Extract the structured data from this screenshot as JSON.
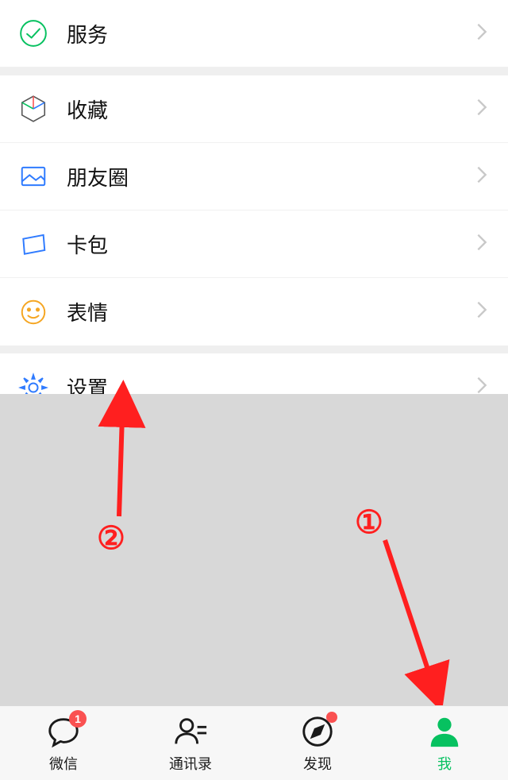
{
  "sections": [
    {
      "items": [
        {
          "id": "services",
          "icon": "service-icon",
          "label": "服务"
        }
      ]
    },
    {
      "items": [
        {
          "id": "favorites",
          "icon": "cube-icon",
          "label": "收藏"
        },
        {
          "id": "moments",
          "icon": "image-icon",
          "label": "朋友圈"
        },
        {
          "id": "cards",
          "icon": "wallet-icon",
          "label": "卡包"
        },
        {
          "id": "stickers",
          "icon": "smile-icon",
          "label": "表情"
        }
      ]
    },
    {
      "items": [
        {
          "id": "settings",
          "icon": "gear-icon",
          "label": "设置"
        }
      ]
    }
  ],
  "tabs": [
    {
      "id": "chats",
      "label": "微信",
      "icon": "chat-bubble-icon",
      "badge_type": "count",
      "badge_value": "1",
      "active": false
    },
    {
      "id": "contacts",
      "label": "通讯录",
      "icon": "contacts-icon",
      "badge_type": "none",
      "badge_value": "",
      "active": false
    },
    {
      "id": "discover",
      "label": "发现",
      "icon": "compass-icon",
      "badge_type": "dot",
      "badge_value": "",
      "active": false
    },
    {
      "id": "me",
      "label": "我",
      "icon": "person-icon",
      "badge_type": "none",
      "badge_value": "",
      "active": true
    }
  ],
  "annotations": {
    "callout_1": "①",
    "callout_2": "②"
  },
  "colors": {
    "accent": "#07c160",
    "badge": "#fa5151",
    "anno": "#ff1f1f"
  }
}
